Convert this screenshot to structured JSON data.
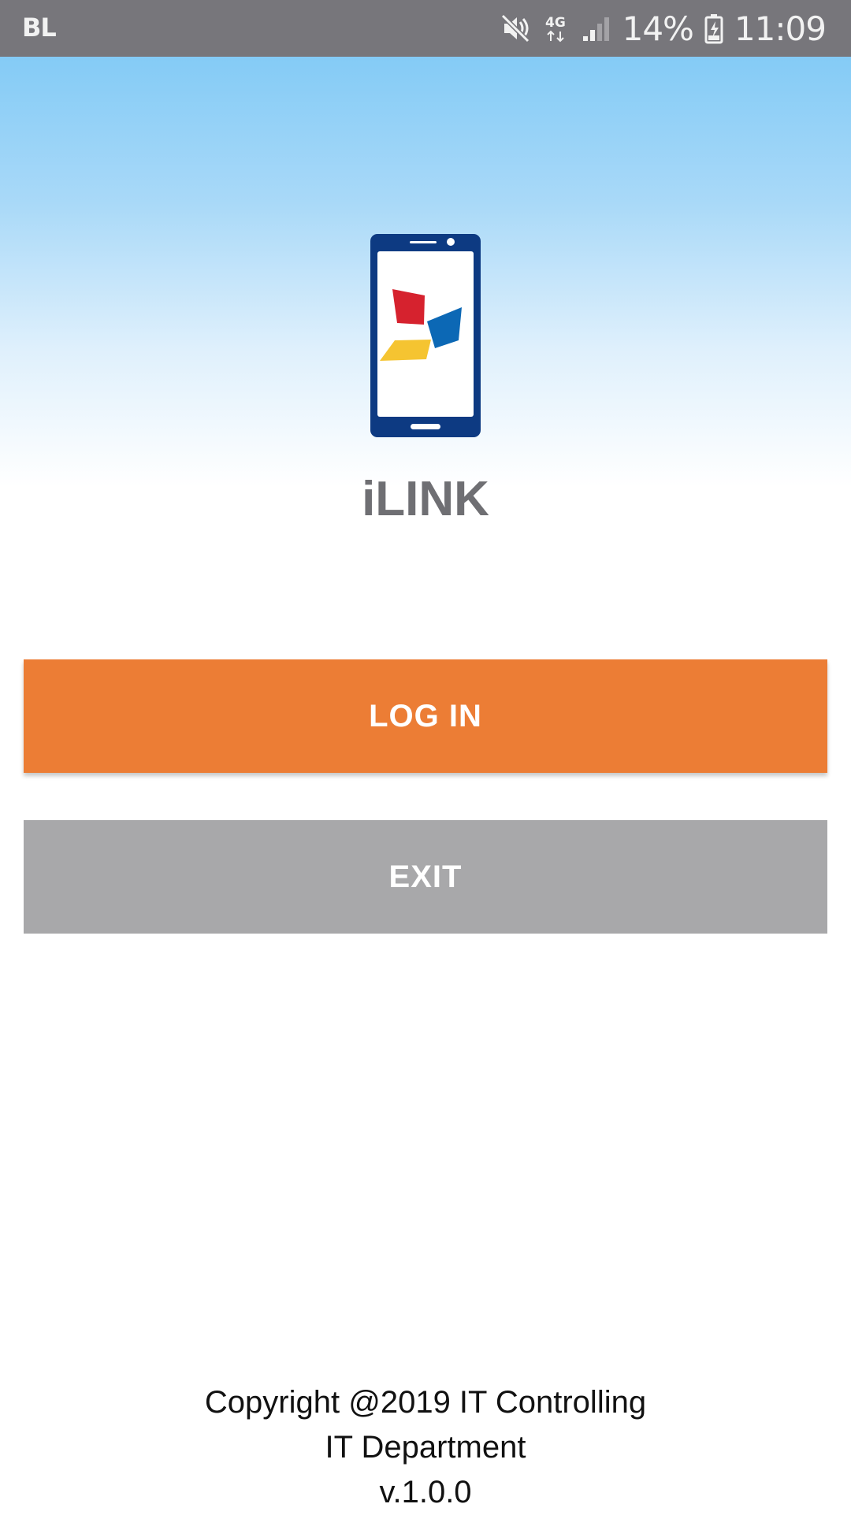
{
  "status_bar": {
    "carrier": "BL",
    "network": "4G",
    "battery_percent": "14%",
    "time": "11:09",
    "icons": [
      "mute-icon",
      "network-4g-icon",
      "signal-icon",
      "battery-charging-icon"
    ]
  },
  "app": {
    "title": "iLINK",
    "logo_icon": "phone-logo-icon"
  },
  "actions": {
    "login_label": "LOG IN",
    "exit_label": "EXIT"
  },
  "footer": {
    "line1": "Copyright @2019 IT Controlling",
    "line2": "IT Department",
    "version": "v.1.0.0"
  },
  "colors": {
    "status_bar": "#77767b",
    "login_button": "#ec7d35",
    "exit_button": "#a8a8aa",
    "title_text": "#6f6f73",
    "hero_gradient_top": "#84cbf6"
  }
}
